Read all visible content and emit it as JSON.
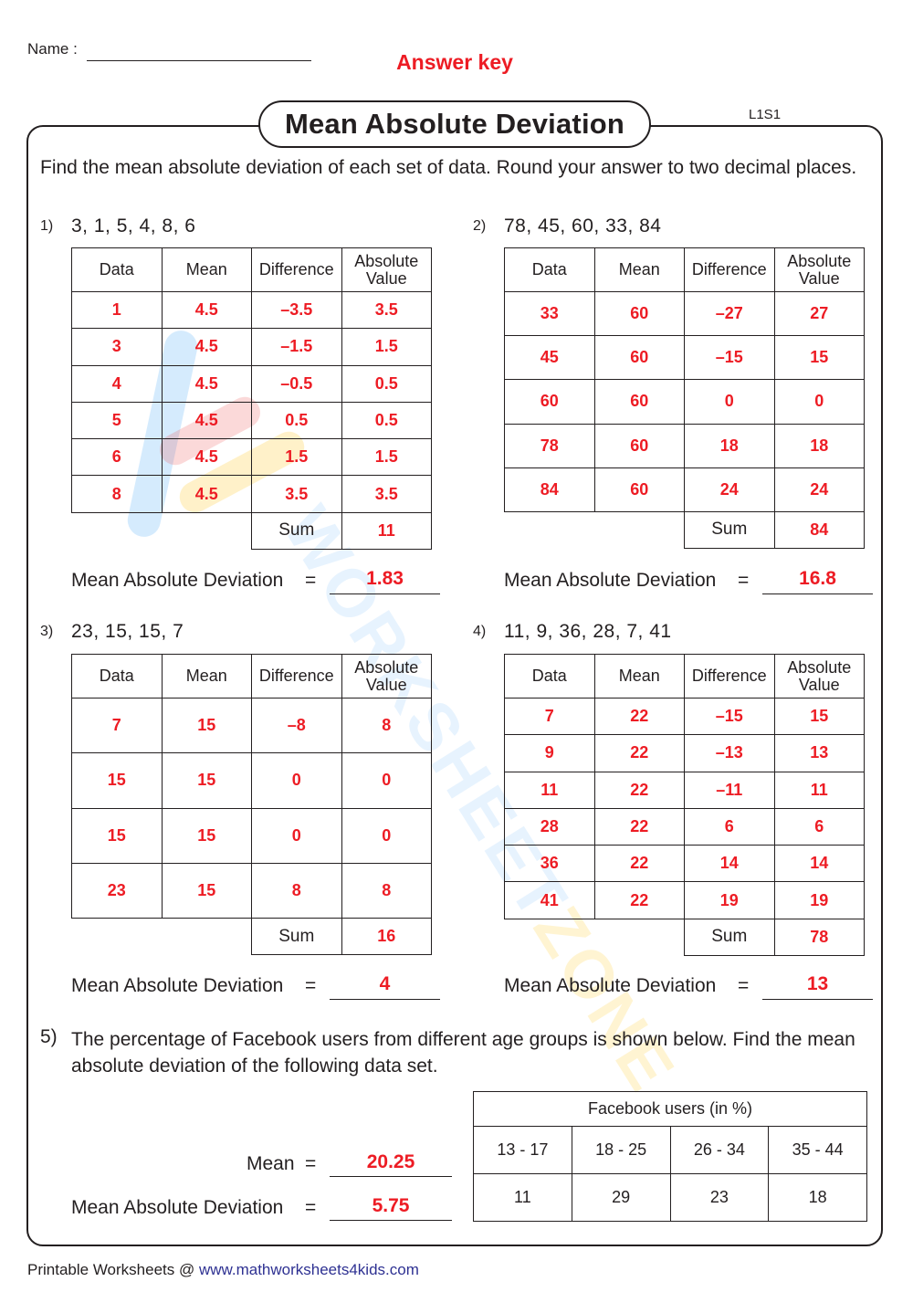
{
  "header": {
    "name_label": "Name :",
    "answer_key": "Answer key",
    "title": "Mean Absolute Deviation",
    "code": "L1S1"
  },
  "instructions": "Find the mean absolute deviation of each set of data. Round your answer to two decimal places.",
  "table_headers": {
    "data": "Data",
    "mean": "Mean",
    "difference": "Difference",
    "absolute_line1": "Absolute",
    "absolute_line2": "Value",
    "sum": "Sum"
  },
  "mad_label": "Mean Absolute Deviation",
  "equals": "=",
  "problems": [
    {
      "number": "1)",
      "data_set": "3, 1, 5, 4, 8, 6",
      "rows": [
        [
          "1",
          "4.5",
          "–3.5",
          "3.5"
        ],
        [
          "3",
          "4.5",
          "–1.5",
          "1.5"
        ],
        [
          "4",
          "4.5",
          "–0.5",
          "0.5"
        ],
        [
          "5",
          "4.5",
          "0.5",
          "0.5"
        ],
        [
          "6",
          "4.5",
          "1.5",
          "1.5"
        ],
        [
          "8",
          "4.5",
          "3.5",
          "3.5"
        ]
      ],
      "sum": "11",
      "mad": "1.83"
    },
    {
      "number": "2)",
      "data_set": "78, 45, 60, 33, 84",
      "rows": [
        [
          "33",
          "60",
          "–27",
          "27"
        ],
        [
          "45",
          "60",
          "–15",
          "15"
        ],
        [
          "60",
          "60",
          "0",
          "0"
        ],
        [
          "78",
          "60",
          "18",
          "18"
        ],
        [
          "84",
          "60",
          "24",
          "24"
        ]
      ],
      "sum": "84",
      "mad": "16.8"
    },
    {
      "number": "3)",
      "data_set": "23, 15, 15, 7",
      "rows": [
        [
          "7",
          "15",
          "–8",
          "8"
        ],
        [
          "15",
          "15",
          "0",
          "0"
        ],
        [
          "15",
          "15",
          "0",
          "0"
        ],
        [
          "23",
          "15",
          "8",
          "8"
        ]
      ],
      "sum": "16",
      "mad": "4"
    },
    {
      "number": "4)",
      "data_set": "11, 9, 36, 28, 7, 41",
      "rows": [
        [
          "7",
          "22",
          "–15",
          "15"
        ],
        [
          "9",
          "22",
          "–13",
          "13"
        ],
        [
          "11",
          "22",
          "–11",
          "11"
        ],
        [
          "28",
          "22",
          "6",
          "6"
        ],
        [
          "36",
          "22",
          "14",
          "14"
        ],
        [
          "41",
          "22",
          "19",
          "19"
        ]
      ],
      "sum": "78",
      "mad": "13"
    }
  ],
  "problem5": {
    "number": "5)",
    "text": "The percentage of Facebook users from different age groups is shown below. Find the mean absolute deviation of the following data set.",
    "table_title": "Facebook users (in %)",
    "age_groups": [
      "13 - 17",
      "18 - 25",
      "26 - 34",
      "35 - 44"
    ],
    "values": [
      "11",
      "29",
      "23",
      "18"
    ],
    "mean_label": "Mean",
    "mean_answer": "20.25",
    "mad_answer": "5.75"
  },
  "footer": {
    "prefix": "Printable Worksheets @ ",
    "url": "www.mathworksheets4kids.com"
  },
  "watermark": {
    "text_main": "WORKSHEET",
    "text_end": "ZONE"
  },
  "colors": {
    "answer_red": "#ed1c24",
    "text": "#231f20",
    "link_blue": "#2e3192"
  }
}
